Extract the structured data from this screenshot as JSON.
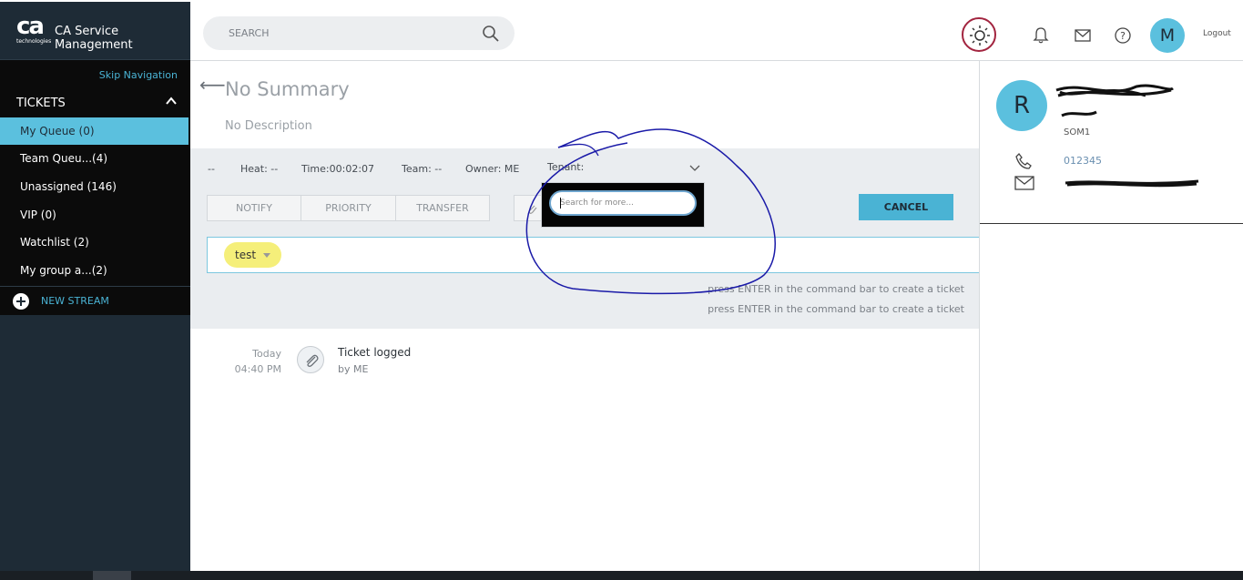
{
  "sidebar": {
    "logo": "ca",
    "logo_sub": "technologies",
    "app_title": "CA Service Management",
    "skip_nav": "Skip Navigation",
    "tickets_label": "TICKETS",
    "items": [
      {
        "label": "My Queue (0)",
        "active": true
      },
      {
        "label": "Team Queu...(4)",
        "active": false
      },
      {
        "label": "Unassigned (146)",
        "active": false
      },
      {
        "label": "VIP (0)",
        "active": false
      },
      {
        "label": "Watchlist (2)",
        "active": false
      },
      {
        "label": "My group a...(2)",
        "active": false
      }
    ],
    "new_stream": "NEW STREAM"
  },
  "topbar": {
    "search_placeholder": "SEARCH",
    "avatar_initial": "M",
    "logout": "Logout",
    "icons": [
      "search-icon",
      "sun-icon",
      "bell-icon",
      "mail-icon",
      "help-icon"
    ]
  },
  "ticket": {
    "summary": "No Summary",
    "description": "No Description",
    "meta": {
      "dash": "--",
      "heat": "Heat: --",
      "time": "Time:00:02:07",
      "team": "Team: --",
      "owner": "Owner: ME",
      "tenant": "Tenant:"
    },
    "actions": [
      "NOTIFY",
      "PRIORITY",
      "TRANSFER"
    ],
    "cancel": "CANCEL",
    "command_tag": "test",
    "hints": [
      "press ENTER in the command bar to create a ticket",
      "press ENTER in the command bar to create a ticket"
    ],
    "tenant_search_placeholder": "Search for more..."
  },
  "activity": {
    "day": "Today",
    "time": "04:40 PM",
    "title": "Ticket logged",
    "by": "by ME"
  },
  "contact": {
    "initial": "R",
    "site": "SOM1",
    "phone": "012345"
  },
  "colors": {
    "accent": "#5bc0de",
    "sidebar_bg": "#1e2b36",
    "annotation": "#1a1aa8",
    "sun_ring": "#a2243f"
  }
}
